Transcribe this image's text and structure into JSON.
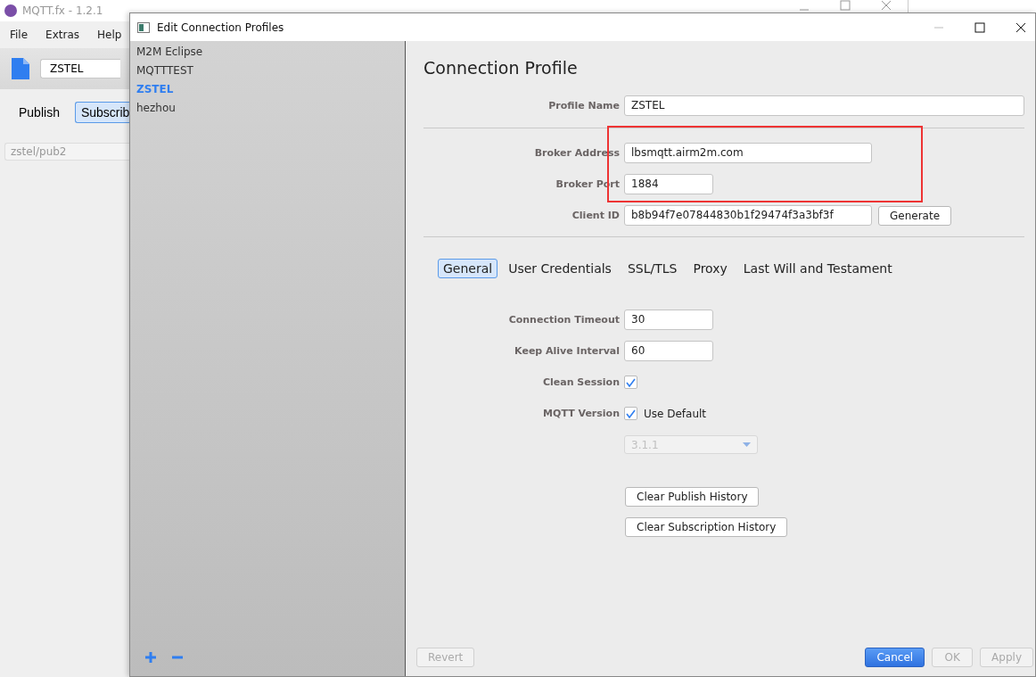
{
  "main_window": {
    "title": "MQTT.fx - 1.2.1",
    "menu": [
      "File",
      "Extras",
      "Help"
    ],
    "profile_combo": "ZSTEL",
    "tabs": [
      {
        "label": "Publish",
        "selected": false
      },
      {
        "label": "Subscrib",
        "selected": true
      }
    ],
    "topic_field": "zstel/pub2"
  },
  "dialog": {
    "title": "Edit Connection Profiles",
    "profiles": [
      {
        "label": "M2M Eclipse",
        "selected": false
      },
      {
        "label": "MQTTTEST",
        "selected": false
      },
      {
        "label": "ZSTEL",
        "selected": true
      },
      {
        "label": "hezhou",
        "selected": false
      }
    ],
    "heading": "Connection Profile",
    "profile_name": {
      "label": "Profile Name",
      "value": "ZSTEL"
    },
    "broker_address": {
      "label": "Broker Address",
      "value": "lbsmqtt.airm2m.com"
    },
    "broker_port": {
      "label": "Broker Port",
      "value": "1884"
    },
    "client_id": {
      "label": "Client ID",
      "value": "b8b94f7e07844830b1f29474f3a3bf3f",
      "button": "Generate"
    },
    "tabs": [
      {
        "label": "General",
        "selected": true
      },
      {
        "label": "User Credentials",
        "selected": false
      },
      {
        "label": "SSL/TLS",
        "selected": false
      },
      {
        "label": "Proxy",
        "selected": false
      },
      {
        "label": "Last Will and Testament",
        "selected": false
      }
    ],
    "connection_timeout": {
      "label": "Connection Timeout",
      "value": "30"
    },
    "keep_alive": {
      "label": "Keep Alive Interval",
      "value": "60"
    },
    "clean_session": {
      "label": "Clean Session",
      "checked": true
    },
    "mqtt_version": {
      "label": "MQTT Version",
      "checked": true,
      "option": "Use Default",
      "value": "3.1.1",
      "disabled": true
    },
    "history_buttons": [
      "Clear Publish History",
      "Clear Subscription History"
    ],
    "revert": {
      "label": "Revert",
      "disabled": true
    },
    "buttons": [
      {
        "label": "Cancel",
        "kind": "primary",
        "disabled": false
      },
      {
        "label": "OK",
        "kind": "plain",
        "disabled": true
      },
      {
        "label": "Apply",
        "kind": "plain",
        "disabled": true
      }
    ]
  }
}
